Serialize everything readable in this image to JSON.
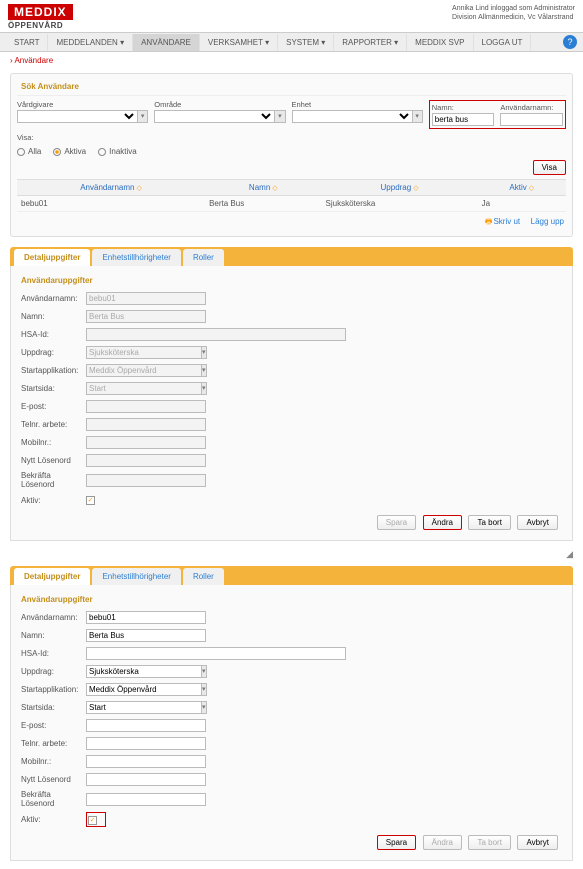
{
  "logo": {
    "main": "MEDDIX",
    "sub": "ÖPPENVÅRD"
  },
  "header_right": {
    "line1": "Annika Lind inloggad som Administrator",
    "line2": "Division Allmänmedicin, Vc Vålarstrand"
  },
  "nav": {
    "start": "START",
    "meddelanden": "MEDDELANDEN",
    "anvandare": "ANVÄNDARE",
    "verksamhet": "VERKSAMHET",
    "system": "SYSTEM",
    "rapporter": "RAPPORTER",
    "svp": "MEDDIX SVP",
    "logga_ut": "LOGGA UT"
  },
  "breadcrumb": "› Användare",
  "search": {
    "title": "Sök Användare",
    "vardgivare": "Vårdgivare",
    "omrade": "Område",
    "enhet": "Enhet",
    "namn": "Namn:",
    "anvandarnamn": "Användarnamn:",
    "namn_val": "berta bus",
    "visa_label": "Visa:",
    "alla": "Alla",
    "aktiva": "Aktiva",
    "inaktiva": "Inaktiva",
    "visa_btn": "Visa"
  },
  "table": {
    "h_anv": "Användarnamn",
    "h_namn": "Namn",
    "h_uppdrag": "Uppdrag",
    "h_aktiv": "Aktiv",
    "r_anv": "bebu01",
    "r_namn": "Berta Bus",
    "r_uppdrag": "Sjuksköterska",
    "r_aktiv": "Ja"
  },
  "actions": {
    "skriv_ut": "Skriv ut",
    "lagg_upp": "Lägg upp"
  },
  "tabs": {
    "detaljuppgifter": "Detaljuppgifter",
    "enhet": "Enhetstillhörigheter",
    "roller": "Roller"
  },
  "form": {
    "subtitle": "Användaruppgifter",
    "anvandarnamn": "Användarnamn:",
    "anvandarnamn_val": "bebu01",
    "namn": "Namn:",
    "namn_val": "Berta Bus",
    "hsa": "HSA-Id:",
    "uppdrag": "Uppdrag:",
    "uppdrag_val": "Sjuksköterska",
    "startapp": "Startapplikation:",
    "startapp_val": "Meddix Öppenvård",
    "startsida": "Startsida:",
    "startsida_val": "Start",
    "epost": "E-post:",
    "tel_arbete": "Telnr. arbete:",
    "mobil": "Mobilnr.:",
    "nytt_losen": "Nytt Lösenord",
    "bekrafta_losen": "Bekräfta Lösenord",
    "aktiv": "Aktiv:"
  },
  "btns": {
    "spara": "Spara",
    "andra": "Ändra",
    "ta_bort": "Ta bort",
    "avbryt": "Avbryt"
  }
}
